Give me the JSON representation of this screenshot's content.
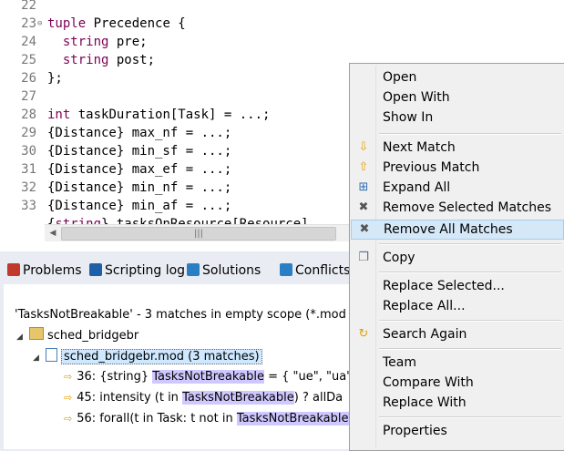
{
  "editor": {
    "lines": [
      {
        "n": "22",
        "code": ""
      },
      {
        "n": "23",
        "code": "tuple Precedence {",
        "fold": true
      },
      {
        "n": "24",
        "code": "  string pre;"
      },
      {
        "n": "25",
        "code": "  string post;"
      },
      {
        "n": "26",
        "code": "};"
      },
      {
        "n": "27",
        "code": ""
      },
      {
        "n": "28",
        "code": "int taskDuration[Task] = ...;"
      },
      {
        "n": "29",
        "code": "{Distance} max_nf = ...;"
      },
      {
        "n": "30",
        "code": "{Distance} min_sf = ...;"
      },
      {
        "n": "31",
        "code": "{Distance} max_ef = ...;"
      },
      {
        "n": "32",
        "code": "{Distance} min_nf = ...;"
      },
      {
        "n": "33",
        "code": "{Distance} min_af = ...;"
      },
      {
        "n": "",
        "code": "{string} tasksOnResource[Resource]"
      }
    ],
    "scrollbar_grip": "|||",
    "scroll_left": "◀"
  },
  "views": {
    "tabs": [
      {
        "label": "Problems",
        "icon": "problems-icon",
        "color": "#c0392b"
      },
      {
        "label": "Scripting log",
        "icon": "scripting-log-icon",
        "color": "#1f5fa8"
      },
      {
        "label": "Solutions",
        "icon": "solutions-icon",
        "color": "#2a7fc4"
      },
      {
        "label": "Conflicts",
        "icon": "conflicts-icon",
        "color": "#2a7fc4"
      }
    ]
  },
  "search": {
    "summary": "'TasksNotBreakable' - 3 matches in empty scope (*.mod",
    "project": "sched_bridgebr",
    "file": "sched_bridgebr.mod (3 matches)",
    "matches": [
      {
        "prefix": "36: {string} ",
        "hit": "TasksNotBreakable",
        "suffix": " = { \"ue\", \"ua\","
      },
      {
        "prefix": "45: intensity (t in ",
        "hit": "TasksNotBreakable",
        "suffix": ") ? allDa"
      },
      {
        "prefix": "56: forall(t in Task: t not in ",
        "hit": "TasksNotBreakable",
        "suffix": ""
      }
    ]
  },
  "menu": {
    "items": [
      {
        "label": "Open",
        "icon": ""
      },
      {
        "label": "Open With",
        "icon": ""
      },
      {
        "label": "Show In",
        "icon": ""
      },
      {
        "sep": true
      },
      {
        "label": "Next Match",
        "icon": "next-match-icon"
      },
      {
        "label": "Previous Match",
        "icon": "previous-match-icon"
      },
      {
        "label": "Expand All",
        "icon": "expand-all-icon"
      },
      {
        "label": "Remove Selected Matches",
        "icon": "remove-selected-icon"
      },
      {
        "label": "Remove All Matches",
        "icon": "remove-all-icon",
        "active": true
      },
      {
        "sep": true
      },
      {
        "label": "Copy",
        "icon": "copy-icon"
      },
      {
        "sep": true
      },
      {
        "label": "Replace Selected...",
        "icon": ""
      },
      {
        "label": "Replace All...",
        "icon": ""
      },
      {
        "sep": true
      },
      {
        "label": "Search Again",
        "icon": "search-again-icon"
      },
      {
        "sep": true
      },
      {
        "label": "Team",
        "icon": ""
      },
      {
        "label": "Compare With",
        "icon": ""
      },
      {
        "label": "Replace With",
        "icon": ""
      },
      {
        "sep": true
      },
      {
        "label": "Properties",
        "icon": ""
      }
    ]
  },
  "colors": {
    "keyword": "#7f0055",
    "type": "#0000c0",
    "highlight": "#cfc8ff",
    "menu_bg": "#f0f0f0",
    "menu_active": "#d5e8f8"
  }
}
